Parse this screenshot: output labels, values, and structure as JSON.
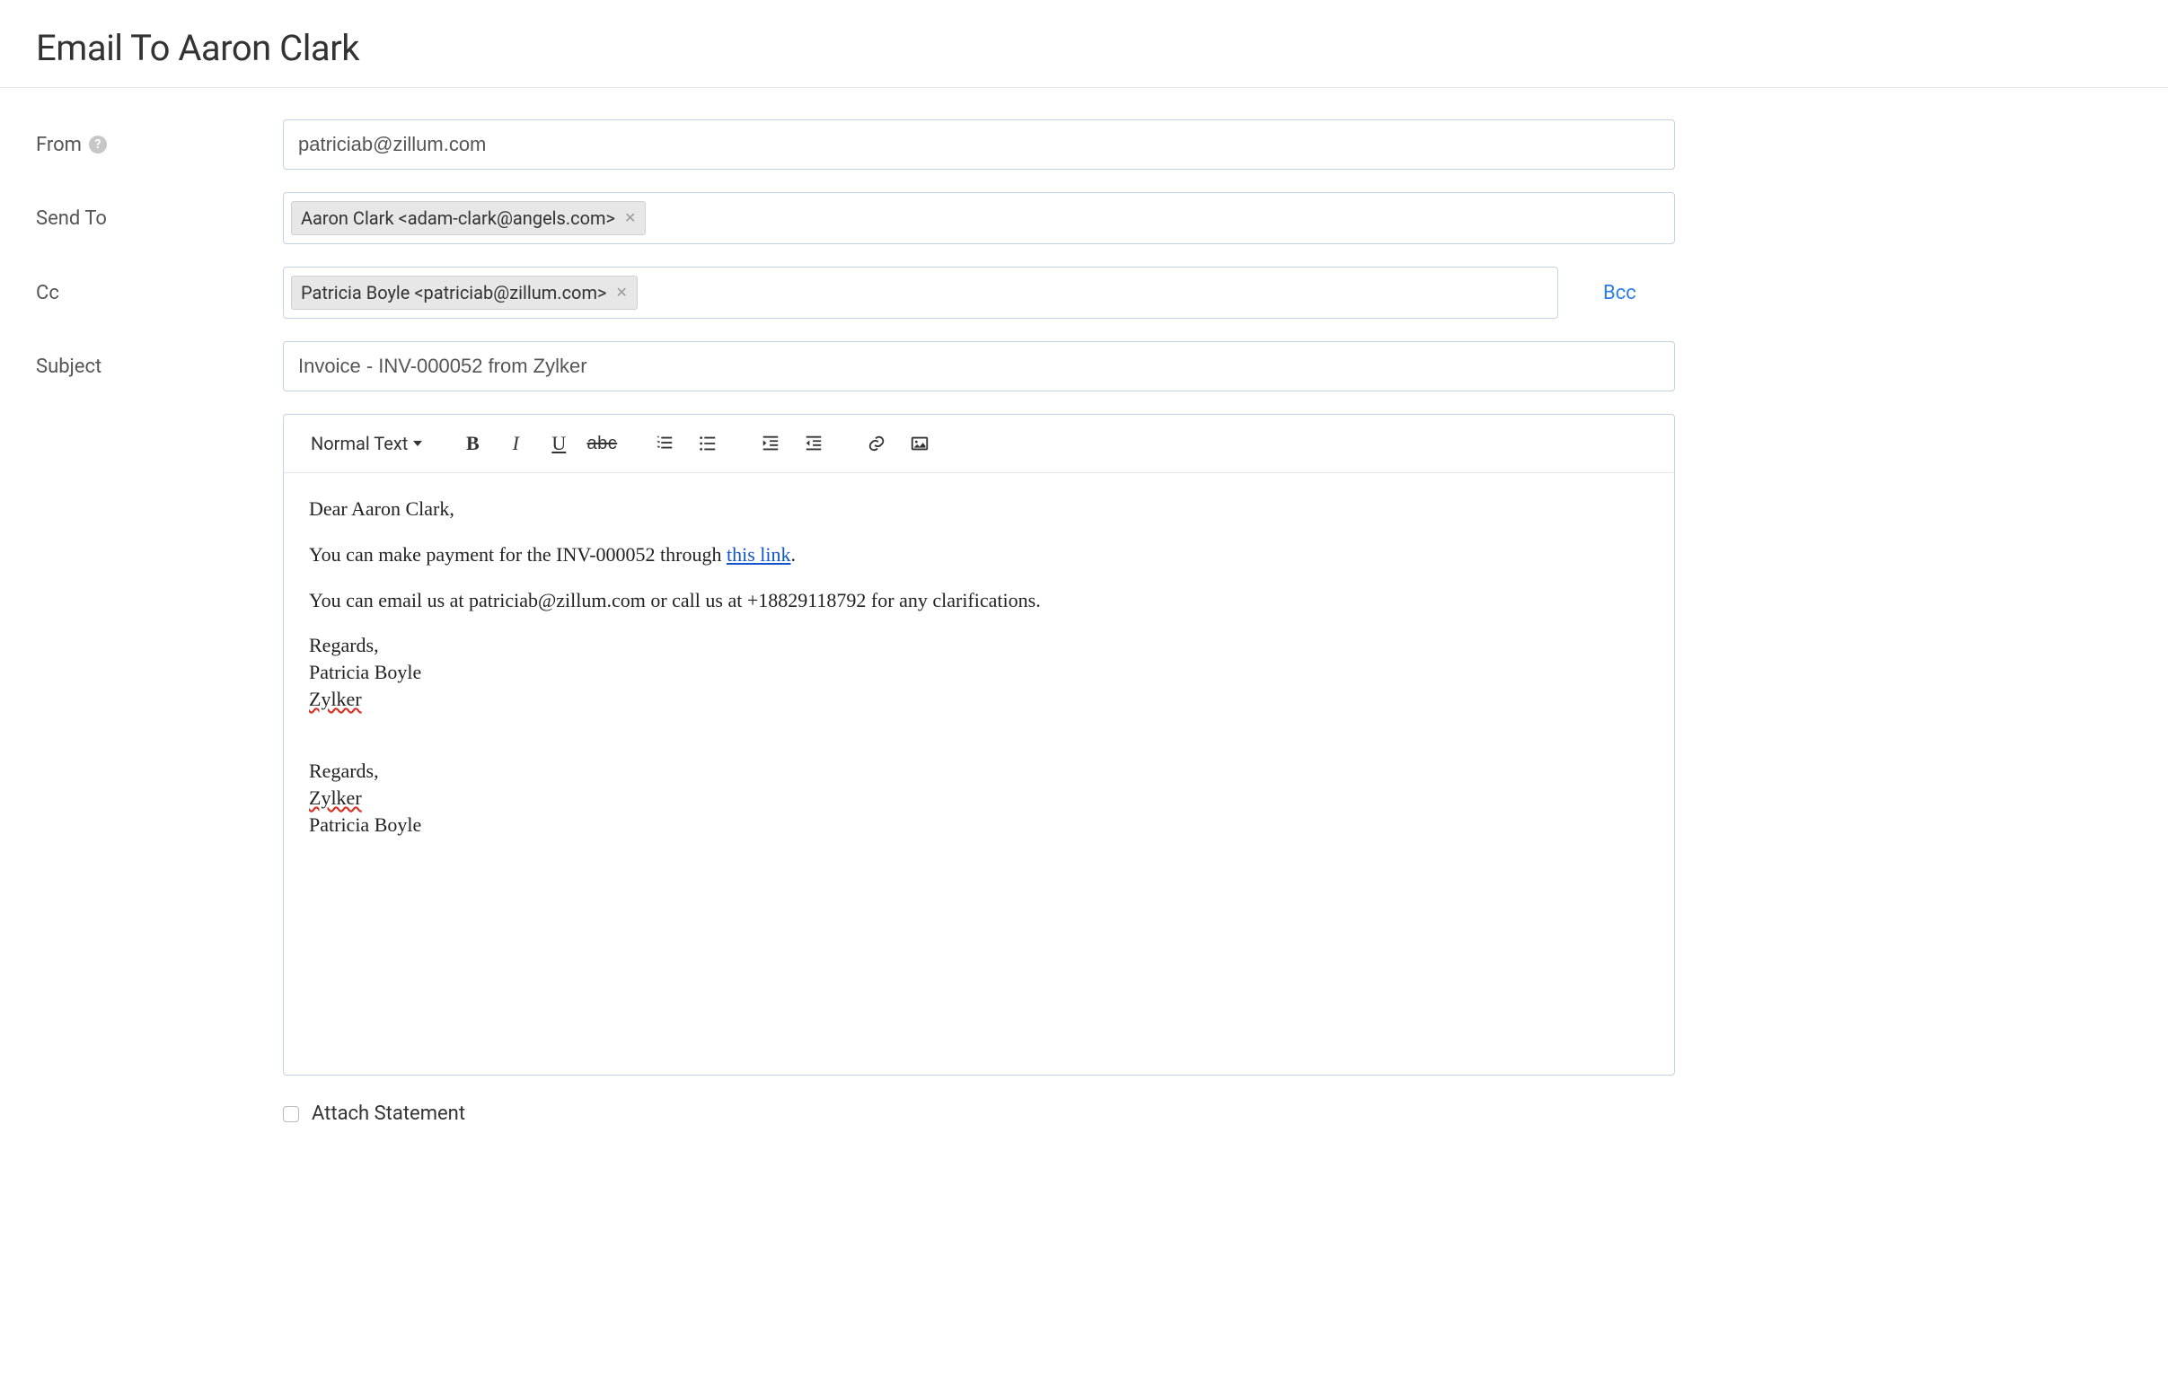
{
  "page": {
    "title": "Email To Aaron Clark"
  },
  "form": {
    "from_label": "From",
    "from_value": "patriciab@zillum.com",
    "sendto_label": "Send To",
    "sendto_chip": "Aaron Clark <adam-clark@angels.com>",
    "cc_label": "Cc",
    "cc_chip": "Patricia Boyle <patriciab@zillum.com>",
    "bcc_link": "Bcc",
    "subject_label": "Subject",
    "subject_value": "Invoice - INV-000052 from Zylker"
  },
  "toolbar": {
    "block_format": "Normal Text",
    "bold": "B",
    "italic": "I",
    "underline": "U",
    "strike": "abc"
  },
  "body": {
    "greeting": "Dear Aaron Clark,",
    "line1_pre": "You can make payment for the INV-000052 through ",
    "line1_link": "this link",
    "line1_post": ".",
    "line2": "You can email us at patriciab@zillum.com or call us at +18829118792 for any clarifications.",
    "sig1_regards": "Regards,",
    "sig1_name": "Patricia Boyle",
    "sig1_company": "Zylker",
    "sig2_regards": "Regards,",
    "sig2_company": "Zylker",
    "sig2_name": "Patricia Boyle"
  },
  "footer": {
    "attach_label": "Attach Statement"
  }
}
